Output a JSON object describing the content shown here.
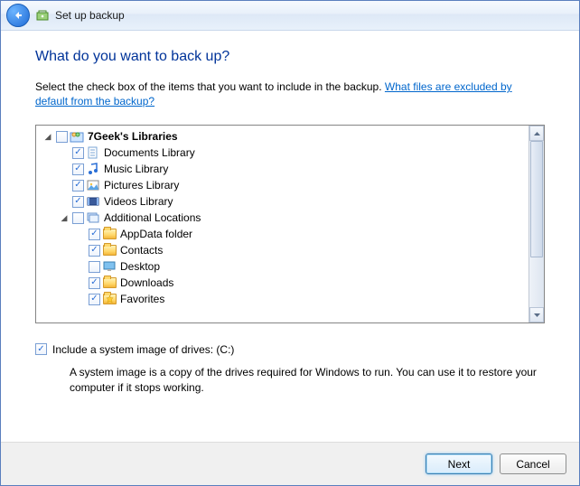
{
  "title": "Set up backup",
  "heading": "What do you want to back up?",
  "instruction_prefix": "Select the check box of the items that you want to include in the backup. ",
  "instruction_link": "What files are excluded by default from the backup?",
  "tree": {
    "root": {
      "label": "7Geek's Libraries",
      "checked": false,
      "expanded": true,
      "icon": "libraries"
    },
    "libs": [
      {
        "label": "Documents Library",
        "checked": true,
        "icon": "doc"
      },
      {
        "label": "Music Library",
        "checked": true,
        "icon": "music"
      },
      {
        "label": "Pictures Library",
        "checked": true,
        "icon": "pic"
      },
      {
        "label": "Videos Library",
        "checked": true,
        "icon": "vid"
      }
    ],
    "additional": {
      "label": "Additional Locations",
      "checked": false,
      "expanded": true,
      "icon": "folder-stack"
    },
    "addl_items": [
      {
        "label": "AppData folder",
        "checked": true,
        "icon": "folder"
      },
      {
        "label": "Contacts",
        "checked": true,
        "icon": "folder"
      },
      {
        "label": "Desktop",
        "checked": false,
        "icon": "desktop"
      },
      {
        "label": "Downloads",
        "checked": true,
        "icon": "folder"
      },
      {
        "label": "Favorites",
        "checked": true,
        "icon": "folder-star"
      }
    ]
  },
  "sysimg": {
    "checked": true,
    "label": "Include a system image of drives: (C:)",
    "desc": "A system image is a copy of the drives required for Windows to run. You can use it to restore your computer if it stops working."
  },
  "buttons": {
    "next": "Next",
    "cancel": "Cancel"
  }
}
